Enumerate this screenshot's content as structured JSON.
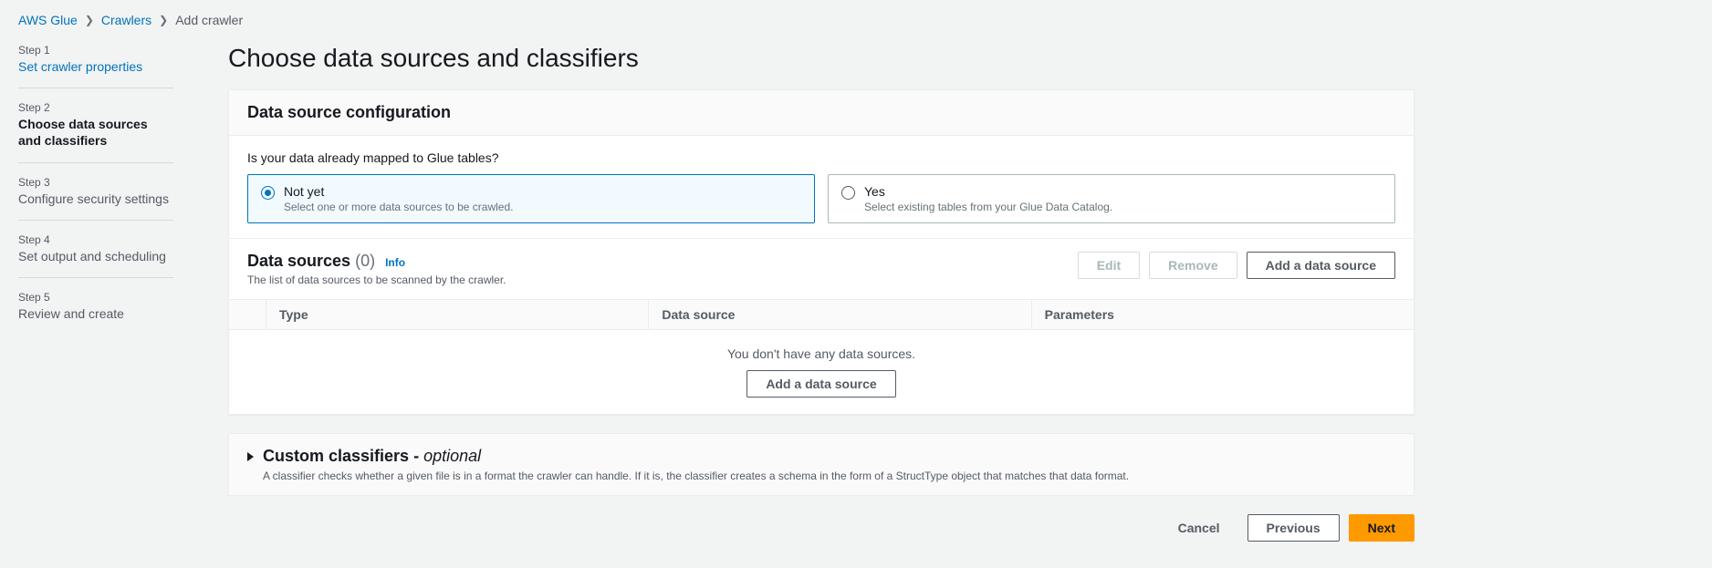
{
  "breadcrumb": {
    "items": [
      {
        "label": "AWS Glue"
      },
      {
        "label": "Crawlers"
      },
      {
        "label": "Add crawler"
      }
    ]
  },
  "sidebar": {
    "steps": [
      {
        "num": "Step 1",
        "title": "Set crawler properties"
      },
      {
        "num": "Step 2",
        "title": "Choose data sources and classifiers"
      },
      {
        "num": "Step 3",
        "title": "Configure security settings"
      },
      {
        "num": "Step 4",
        "title": "Set output and scheduling"
      },
      {
        "num": "Step 5",
        "title": "Review and create"
      }
    ]
  },
  "page_title": "Choose data sources and classifiers",
  "config_panel": {
    "title": "Data source configuration",
    "question": "Is your data already mapped to Glue tables?",
    "options": [
      {
        "title": "Not yet",
        "desc": "Select one or more data sources to be crawled."
      },
      {
        "title": "Yes",
        "desc": "Select existing tables from your Glue Data Catalog."
      }
    ]
  },
  "data_sources": {
    "title": "Data sources",
    "count": "(0)",
    "info": "Info",
    "subtitle": "The list of data sources to be scanned by the crawler.",
    "buttons": {
      "edit": "Edit",
      "remove": "Remove",
      "add": "Add a data source"
    },
    "columns": {
      "type": "Type",
      "source": "Data source",
      "params": "Parameters"
    },
    "empty_msg": "You don't have any data sources.",
    "empty_btn": "Add a data source"
  },
  "classifiers": {
    "title": "Custom classifiers - ",
    "optional": "optional",
    "desc": "A classifier checks whether a given file is in a format the crawler can handle. If it is, the classifier creates a schema in the form of a StructType object that matches that data format."
  },
  "footer": {
    "cancel": "Cancel",
    "previous": "Previous",
    "next": "Next"
  }
}
